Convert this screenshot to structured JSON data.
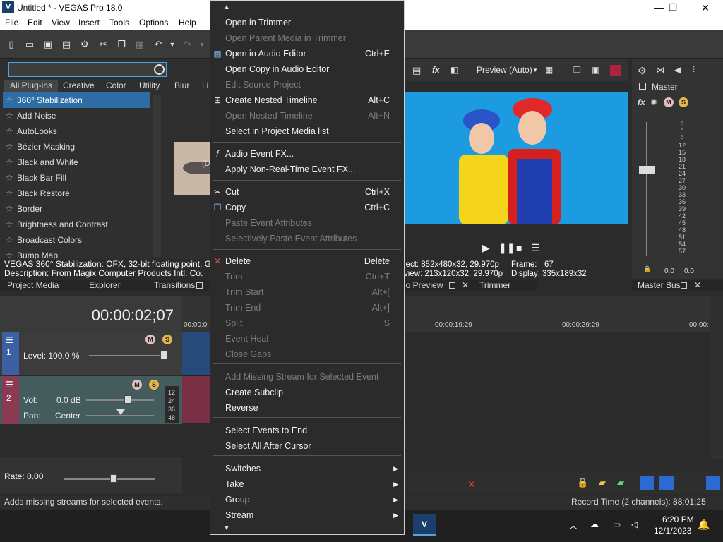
{
  "window": {
    "title": "Untitled * - VEGAS Pro 18.0",
    "app_icon": "V"
  },
  "menubar": [
    "File",
    "Edit",
    "View",
    "Insert",
    "Tools",
    "Options",
    "Help"
  ],
  "plugins": {
    "tabs": [
      "All Plug-ins",
      "Creative",
      "Color",
      "Utility",
      "Blur",
      "Li"
    ],
    "items": [
      "360° Stabilization",
      "Add Noise",
      "AutoLooks",
      "Bézier Masking",
      "Black and White",
      "Black Bar Fill",
      "Black Restore",
      "Border",
      "Brightness and Contrast",
      "Broadcast Colors",
      "Bump Map"
    ],
    "thumb_caption": "(D",
    "description_line1": "VEGAS 360° Stabilization: OFX, 32-bit floating point, Group",
    "description_line2": "Description: From Magix Computer Products Intl. Co."
  },
  "left_tabs": [
    "Project Media",
    "Explorer",
    "Transitions"
  ],
  "timeline": {
    "timecode": "00:00:02;07",
    "track1": {
      "number": "1",
      "level_label": "Level: 100.0 %"
    },
    "track2": {
      "number": "2",
      "vol_label": "Vol:",
      "vol_value": "0.0 dB",
      "pan_label": "Pan:",
      "pan_value": "Center",
      "meter_ticks": [
        "12",
        "24",
        "36",
        "48"
      ]
    },
    "ruler_marks": [
      "00:00:0",
      "00:00:19:29",
      "00:00:29:29",
      "00:00:"
    ],
    "rate_label": "Rate: 0.00"
  },
  "preview": {
    "mode": "Preview (Auto)",
    "project_info": "ject:   852x480x32, 29.970p",
    "frame_label": "Frame:",
    "frame_value": "67",
    "preview_info": "view:  213x120x32, 29.970p",
    "display_label": "Display:",
    "display_value": "335x189x32",
    "tabs": [
      "eo Preview",
      "Trimmer"
    ]
  },
  "master": {
    "label": "Master",
    "bus_label": "Master Bus",
    "db_ticks": [
      "3",
      "6",
      "9",
      "12",
      "15",
      "18",
      "21",
      "24",
      "27",
      "30",
      "33",
      "36",
      "39",
      "42",
      "45",
      "48",
      "51",
      "54",
      "57"
    ],
    "left_reading": "0.0",
    "right_reading": "0.0"
  },
  "statusbar": {
    "message": "Adds missing streams for selected events.",
    "record_time": "Record Time (2 channels): 88:01:25"
  },
  "taskbar": {
    "time": "6:20 PM",
    "date": "12/1/2023"
  },
  "context_menu": {
    "items": [
      {
        "label": "Open in Trimmer",
        "shortcut": "",
        "enabled": true,
        "icon": ""
      },
      {
        "label": "Open Parent Media in Trimmer",
        "shortcut": "",
        "enabled": false,
        "icon": ""
      },
      {
        "label": "Open in Audio Editor",
        "shortcut": "Ctrl+E",
        "enabled": true,
        "icon": "audio-editor-icon"
      },
      {
        "label": "Open Copy in Audio Editor",
        "shortcut": "",
        "enabled": true,
        "icon": ""
      },
      {
        "label": "Edit Source Project",
        "shortcut": "",
        "enabled": false,
        "icon": ""
      },
      {
        "label": "Create Nested Timeline",
        "shortcut": "Alt+C",
        "enabled": true,
        "icon": "nested-timeline-icon"
      },
      {
        "label": "Open Nested Timeline",
        "shortcut": "Alt+N",
        "enabled": false,
        "icon": ""
      },
      {
        "label": "Select in Project Media list",
        "shortcut": "",
        "enabled": true,
        "icon": ""
      },
      {
        "label": "Audio Event FX...",
        "shortcut": "",
        "enabled": true,
        "icon": "fx-icon"
      },
      {
        "label": "Apply Non-Real-Time Event FX...",
        "shortcut": "",
        "enabled": true,
        "icon": ""
      },
      {
        "label": "Cut",
        "shortcut": "Ctrl+X",
        "enabled": true,
        "icon": "scissors-icon"
      },
      {
        "label": "Copy",
        "shortcut": "Ctrl+C",
        "enabled": true,
        "icon": "copy-icon"
      },
      {
        "label": "Paste Event Attributes",
        "shortcut": "",
        "enabled": false,
        "icon": ""
      },
      {
        "label": "Selectively Paste Event Attributes",
        "shortcut": "",
        "enabled": false,
        "icon": ""
      },
      {
        "label": "Delete",
        "shortcut": "Delete",
        "enabled": true,
        "icon": "delete-icon"
      },
      {
        "label": "Trim",
        "shortcut": "Ctrl+T",
        "enabled": false,
        "icon": ""
      },
      {
        "label": "Trim Start",
        "shortcut": "Alt+[",
        "enabled": false,
        "icon": ""
      },
      {
        "label": "Trim End",
        "shortcut": "Alt+]",
        "enabled": false,
        "icon": ""
      },
      {
        "label": "Split",
        "shortcut": "S",
        "enabled": false,
        "icon": ""
      },
      {
        "label": "Event Heal",
        "shortcut": "",
        "enabled": false,
        "icon": ""
      },
      {
        "label": "Close Gaps",
        "shortcut": "",
        "enabled": false,
        "icon": ""
      },
      {
        "label": "Add Missing Stream for Selected Event",
        "shortcut": "",
        "enabled": false,
        "icon": ""
      },
      {
        "label": "Create Subclip",
        "shortcut": "",
        "enabled": true,
        "icon": ""
      },
      {
        "label": "Reverse",
        "shortcut": "",
        "enabled": true,
        "icon": ""
      },
      {
        "label": "Select Events to End",
        "shortcut": "",
        "enabled": true,
        "icon": ""
      },
      {
        "label": "Select All After Cursor",
        "shortcut": "",
        "enabled": true,
        "icon": ""
      },
      {
        "label": "Switches",
        "shortcut": "",
        "enabled": true,
        "icon": "",
        "submenu": true
      },
      {
        "label": "Take",
        "shortcut": "",
        "enabled": true,
        "icon": "",
        "submenu": true
      },
      {
        "label": "Group",
        "shortcut": "",
        "enabled": true,
        "icon": "",
        "submenu": true
      },
      {
        "label": "Stream",
        "shortcut": "",
        "enabled": true,
        "icon": "",
        "submenu": true
      }
    ]
  },
  "colors": {
    "accent_blue": "#2d6ca5",
    "track1_color": "#3d5fa3",
    "track2_color": "#8c3a52",
    "video_bg": "#1d9be0"
  }
}
